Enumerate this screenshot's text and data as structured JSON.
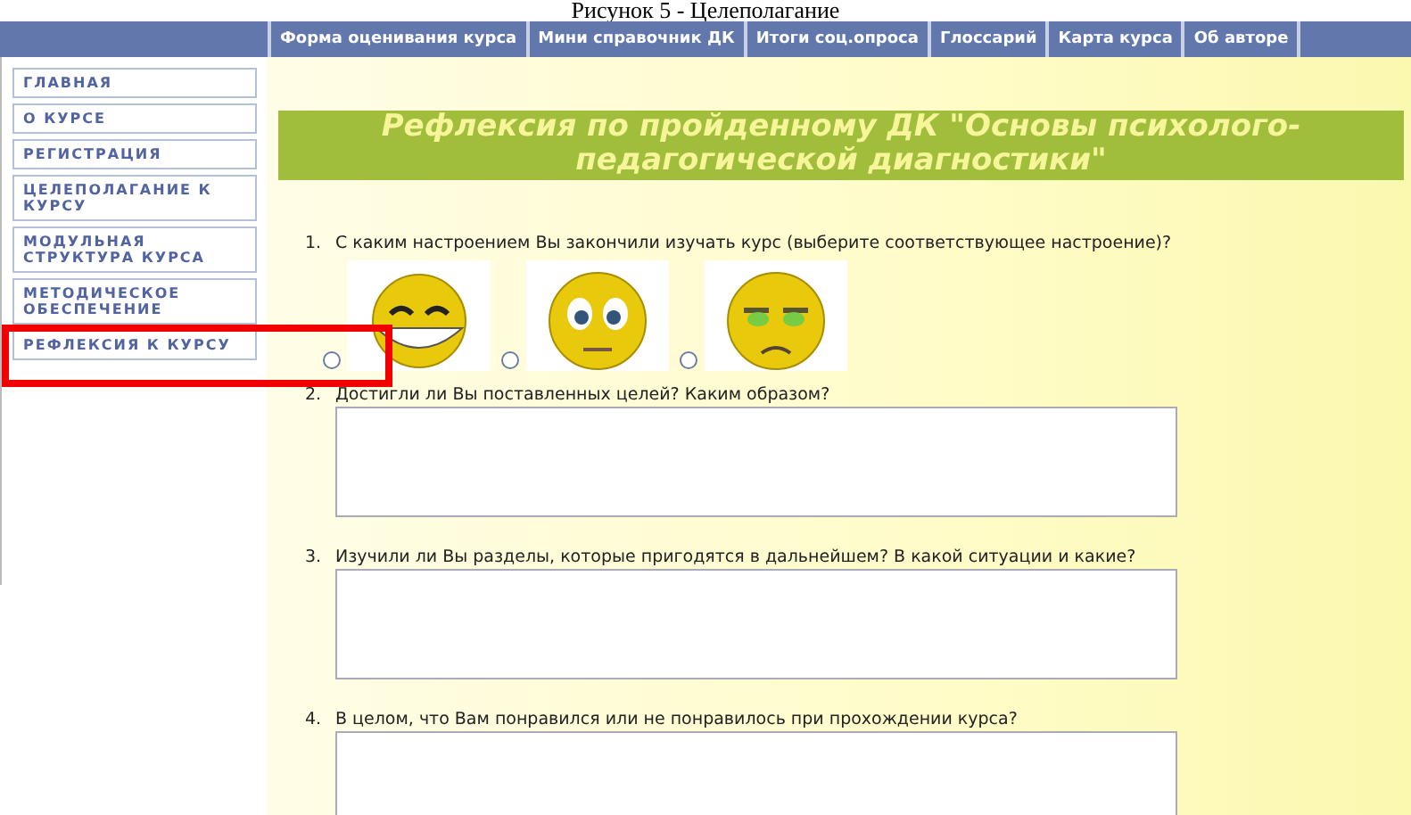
{
  "caption": "Рисунок 5 - Целеполагание",
  "nav": [
    {
      "label": "Форма оценивания курса"
    },
    {
      "label": "Мини справочник ДК"
    },
    {
      "label": "Итоги соц.опроса"
    },
    {
      "label": "Глоссарий"
    },
    {
      "label": "Карта курса"
    },
    {
      "label": "Об авторе"
    }
  ],
  "sidebar": {
    "items": [
      {
        "label": "ГЛАВНАЯ",
        "highlighted": false
      },
      {
        "label": "О КУРСЕ",
        "highlighted": false
      },
      {
        "label": "РЕГИСТРАЦИЯ",
        "highlighted": false
      },
      {
        "label": "ЦЕЛЕПОЛАГАНИЕ К КУРСУ",
        "highlighted": false
      },
      {
        "label": "МОДУЛЬНАЯ СТРУКТУРА КУРСА",
        "highlighted": false
      },
      {
        "label": "МЕТОДИЧЕСКОЕ ОБЕСПЕЧЕНИЕ",
        "highlighted": false
      },
      {
        "label": "РЕФЛЕКСИЯ К КУРСУ",
        "highlighted": true
      }
    ]
  },
  "title": "Рефлексия по пройденному ДК \"Основы психолого-педагогической диагностики\"",
  "questions": [
    {
      "number": "1.",
      "text": "С каким настроением Вы закончили изучать курс (выберите соответствующее настроение)?",
      "kind": "mood",
      "options": [
        {
          "kind": "happy",
          "selected": false
        },
        {
          "kind": "neutral",
          "selected": false
        },
        {
          "kind": "sad",
          "selected": false
        }
      ]
    },
    {
      "number": "2.",
      "text": "Достигли ли Вы поставленных целей? Каким образом?",
      "kind": "text"
    },
    {
      "number": "3.",
      "text": "Изучили ли Вы разделы, которые пригодятся в дальнейшем? В какой ситуации и какие?",
      "kind": "text"
    },
    {
      "number": "4.",
      "text": "В целом, что Вам понравился или не понравилось при прохождении курса?",
      "kind": "text"
    }
  ]
}
